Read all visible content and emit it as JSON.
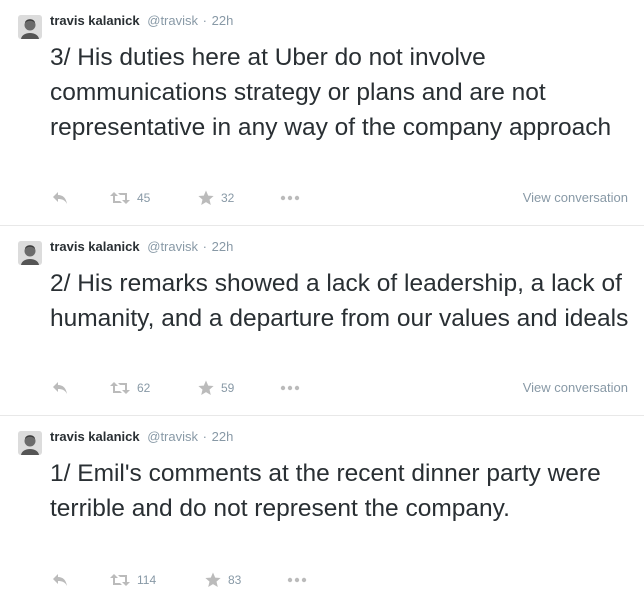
{
  "tweets": [
    {
      "fullname": "travis kalanick",
      "username": "@travisk",
      "separator": "·",
      "time": "22h",
      "text": "3/ His duties here at Uber do not involve communications strategy or plans and are not representative in any way of the company approach",
      "retweets": "45",
      "favorites": "32",
      "view_conversation": "View conversation"
    },
    {
      "fullname": "travis kalanick",
      "username": "@travisk",
      "separator": "·",
      "time": "22h",
      "text": "2/ His remarks showed a lack of leadership, a lack of humanity, and a departure from our values and ideals",
      "retweets": "62",
      "favorites": "59",
      "view_conversation": "View conversation"
    },
    {
      "fullname": "travis kalanick",
      "username": "@travisk",
      "separator": "·",
      "time": "22h",
      "text": "1/ Emil's comments at the recent dinner party were terrible and do not represent the company.",
      "retweets": "114",
      "favorites": "83"
    }
  ],
  "icons": {
    "reply": "reply-icon",
    "retweet": "retweet-icon",
    "favorite": "star-icon",
    "more": "more-dots-icon",
    "avatar": "avatar-portrait"
  },
  "colors": {
    "text": "#292f33",
    "muted": "#8899a6",
    "icon": "#bbbbbb"
  }
}
